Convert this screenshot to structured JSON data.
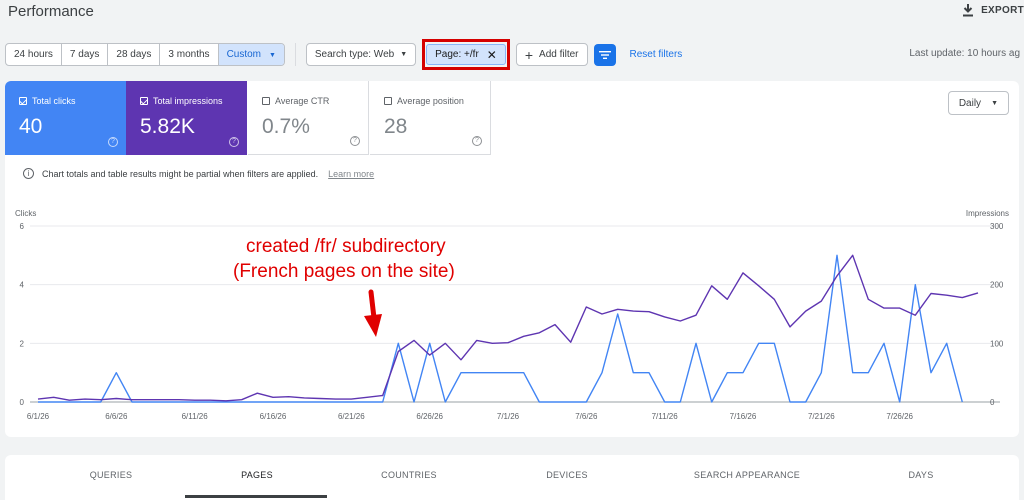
{
  "header": {
    "title": "Performance",
    "export_label": "EXPORT"
  },
  "filters": {
    "date_ranges": [
      {
        "label": "24 hours",
        "active": false
      },
      {
        "label": "7 days",
        "active": false
      },
      {
        "label": "28 days",
        "active": false
      },
      {
        "label": "3 months",
        "active": false
      },
      {
        "label": "Custom",
        "active": true
      }
    ],
    "search_type_label": "Search type: Web",
    "page_filter_label": "Page: +/fr",
    "add_filter_label": "Add filter",
    "reset_label": "Reset filters",
    "last_update": "Last update: 10 hours ag"
  },
  "metrics": {
    "clicks": {
      "label": "Total clicks",
      "value": "40"
    },
    "impressions": {
      "label": "Total impressions",
      "value": "5.82K"
    },
    "ctr": {
      "label": "Average CTR",
      "value": "0.7%"
    },
    "position": {
      "label": "Average position",
      "value": "28"
    }
  },
  "granularity": "Daily",
  "notice": {
    "text": "Chart totals and table results might be partial when filters are applied.",
    "link": "Learn more"
  },
  "annotation": {
    "line1": "created /fr/ subdirectory",
    "line2": "(French pages on the site)",
    "color": "#e00000"
  },
  "colors": {
    "clicks": "#4285f4",
    "impressions": "#5e35b1",
    "highlight": "#d50000"
  },
  "tabs": [
    {
      "label": "QUERIES",
      "active": false
    },
    {
      "label": "PAGES",
      "active": true
    },
    {
      "label": "COUNTRIES",
      "active": false
    },
    {
      "label": "DEVICES",
      "active": false
    },
    {
      "label": "SEARCH APPEARANCE",
      "active": false
    },
    {
      "label": "DAYS",
      "active": false
    }
  ],
  "chart_data": {
    "type": "line",
    "y_left_label": "Clicks",
    "y_right_label": "Impressions",
    "y_left_ticks": [
      "6",
      "4",
      "2",
      "0"
    ],
    "y_right_ticks": [
      "300",
      "200",
      "100",
      "0"
    ],
    "ylim_left": [
      0,
      6
    ],
    "ylim_right": [
      0,
      300
    ],
    "x_tick_labels": [
      "6/1/26",
      "6/6/26",
      "6/11/26",
      "6/16/26",
      "6/21/26",
      "6/26/26",
      "7/1/26",
      "7/6/26",
      "7/11/26",
      "7/16/26",
      "7/21/26",
      "7/26/26"
    ],
    "x_tick_indices": [
      0,
      5,
      10,
      15,
      20,
      25,
      30,
      35,
      40,
      45,
      50,
      55
    ],
    "grid": true,
    "series": [
      {
        "name": "Clicks",
        "axis": "left",
        "values": [
          0,
          0,
          0,
          0,
          0,
          1,
          0,
          0,
          0,
          0,
          0,
          0,
          0,
          0,
          0,
          0,
          0,
          0,
          0,
          0,
          0,
          0,
          0,
          2,
          0,
          2,
          0,
          1,
          1,
          1,
          1,
          1,
          0,
          0,
          0,
          0,
          1,
          3,
          1,
          1,
          0,
          0,
          2,
          0,
          1,
          1,
          2,
          2,
          0,
          0,
          1,
          5,
          1,
          1,
          2,
          0,
          4,
          1,
          2,
          0
        ]
      },
      {
        "name": "Impressions",
        "axis": "right",
        "values": [
          5,
          8,
          3,
          5,
          4,
          6,
          4,
          4,
          4,
          4,
          3,
          3,
          2,
          4,
          15,
          8,
          9,
          7,
          6,
          5,
          5,
          8,
          11,
          86,
          105,
          80,
          100,
          72,
          105,
          100,
          101,
          112,
          118,
          132,
          102,
          162,
          150,
          158,
          155,
          154,
          145,
          138,
          148,
          198,
          175,
          220,
          198,
          175,
          128,
          155,
          172,
          215,
          250,
          175,
          160,
          160,
          148,
          185,
          182,
          178,
          186
        ]
      }
    ]
  }
}
